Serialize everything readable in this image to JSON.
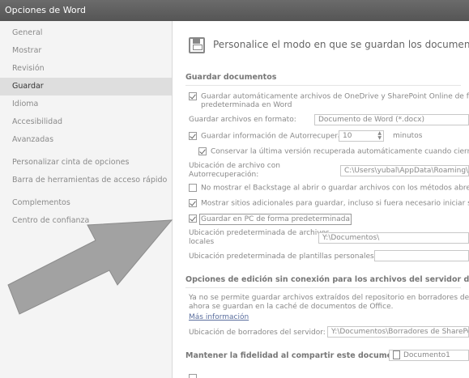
{
  "window": {
    "title": "Opciones de Word"
  },
  "sidebar": {
    "items": [
      {
        "label": "General"
      },
      {
        "label": "Mostrar"
      },
      {
        "label": "Revisión"
      },
      {
        "label": "Guardar"
      },
      {
        "label": "Idioma"
      },
      {
        "label": "Accesibilidad"
      },
      {
        "label": "Avanzadas"
      },
      {
        "label": "Personalizar cinta de opciones"
      },
      {
        "label": "Barra de herramientas de acceso rápido"
      },
      {
        "label": "Complementos"
      },
      {
        "label": "Centro de confianza"
      }
    ],
    "selected": "Guardar"
  },
  "main": {
    "header": "Personalice el modo en que se guardan los documentos.",
    "save_section": {
      "title": "Guardar documentos",
      "autosave_line1": "Guardar automáticamente archivos de OneDrive y SharePoint Online de forma",
      "autosave_line2": "predeterminada en Word",
      "format_label": "Guardar archivos en formato:",
      "format_value": "Documento de Word (*.docx)",
      "autorecover_label": "Guardar información de Autorrecuperación cada",
      "autorecover_value": "10",
      "autorecover_unit": "minutos",
      "keep_last_label": "Conservar la última versión recuperada automáticamente cuando cierro sin",
      "autorecover_location_label_1": "Ubicación de archivo con",
      "autorecover_location_label_2": "Autorrecuperación:",
      "autorecover_location_value": "C:\\Users\\yubal\\AppData\\Roaming\\",
      "backstage_label": "No mostrar el Backstage al abrir o guardar archivos con los métodos abreviados",
      "show_places_label": "Mostrar sitios adicionales para guardar, incluso si fuera necesario iniciar sesión",
      "save_pc_label": "Guardar en PC de forma predeterminada",
      "local_location_label_1": "Ubicación predeterminada de archivos",
      "local_location_label_2": "locales",
      "local_location_value": "Y:\\Documentos\\",
      "templates_label": "Ubicación predeterminada de plantillas personales:",
      "templates_value": ""
    },
    "offline_section": {
      "title": "Opciones de edición sin conexión para los archivos del servidor de administración",
      "desc_line1": "Ya no se permite guardar archivos extraídos del repositorio en borradores del servidor",
      "desc_line2": "ahora se guardan en la caché de documentos de Office.",
      "more_info": "Más información",
      "drafts_label": "Ubicación de borradores del servidor:",
      "drafts_value": "Y:\\Documentos\\Borradores de SharePoint"
    },
    "fidelity": {
      "label": "Mantener la fidelidad al compartir este documento:",
      "doc_value": "Documento1"
    }
  },
  "colors": {
    "titlebar": "#5e5e5e",
    "selected_bg": "#dedede",
    "arrow": "#9a9a9a"
  }
}
